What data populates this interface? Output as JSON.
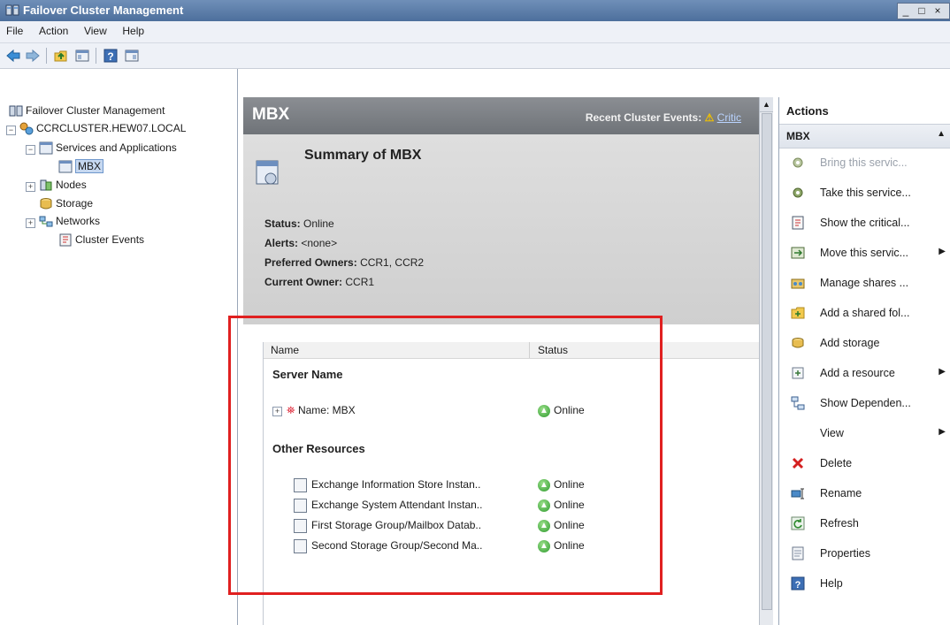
{
  "window": {
    "title": "Failover Cluster Management",
    "controls": [
      "_",
      "□",
      "×"
    ]
  },
  "menu": [
    "File",
    "Action",
    "View",
    "Help"
  ],
  "tree": {
    "root": "Failover Cluster Management",
    "cluster": "CCRCLUSTER.HEW07.LOCAL",
    "services": "Services and Applications",
    "mbx": "MBX",
    "nodes": "Nodes",
    "storage": "Storage",
    "networks": "Networks",
    "events": "Cluster Events"
  },
  "center": {
    "header_name": "MBX",
    "recent_events_label": "Recent Cluster Events:",
    "recent_events_link": "Critic",
    "summary_title": "Summary of MBX",
    "status_label": "Status:",
    "status_value": "Online",
    "alerts_label": "Alerts:",
    "alerts_value": "<none>",
    "owners_label": "Preferred Owners:",
    "owners_value": "CCR1, CCR2",
    "current_label": "Current Owner:",
    "current_value": "CCR1"
  },
  "list": {
    "col_name": "Name",
    "col_status": "Status",
    "group1": "Server Name",
    "server_row": {
      "name": "Name: MBX",
      "status": "Online"
    },
    "group2": "Other Resources",
    "resources": [
      {
        "name": "Exchange Information Store Instan..",
        "status": "Online"
      },
      {
        "name": "Exchange System Attendant Instan..",
        "status": "Online"
      },
      {
        "name": "First Storage Group/Mailbox Datab..",
        "status": "Online"
      },
      {
        "name": "Second Storage Group/Second Ma..",
        "status": "Online"
      }
    ]
  },
  "actions": {
    "header": "Actions",
    "section": "MBX",
    "items": [
      {
        "label": "Bring this servic...",
        "disabled": true,
        "icon": "gear-icon"
      },
      {
        "label": "Take this service...",
        "icon": "gear-icon"
      },
      {
        "label": "Show the critical...",
        "icon": "log-icon"
      },
      {
        "label": "Move this servic...",
        "icon": "move-icon",
        "submenu": true
      },
      {
        "label": "Manage shares ...",
        "icon": "share-icon"
      },
      {
        "label": "Add a shared fol...",
        "icon": "folder-icon"
      },
      {
        "label": "Add storage",
        "icon": "storage-icon"
      },
      {
        "label": "Add a resource",
        "icon": "resource-icon",
        "submenu": true
      },
      {
        "label": "Show Dependen...",
        "icon": "dependency-icon"
      },
      {
        "label": "View",
        "icon": "none",
        "submenu": true
      },
      {
        "label": "Delete",
        "icon": "delete-icon"
      },
      {
        "label": "Rename",
        "icon": "rename-icon"
      },
      {
        "label": "Refresh",
        "icon": "refresh-icon"
      },
      {
        "label": "Properties",
        "icon": "properties-icon"
      },
      {
        "label": "Help",
        "icon": "help-icon"
      }
    ]
  },
  "colors": {
    "title_bar": "#5a7cab",
    "header_bar": "#7d8186",
    "highlight_box": "#e02020",
    "online_green": "#2e9a2e"
  }
}
